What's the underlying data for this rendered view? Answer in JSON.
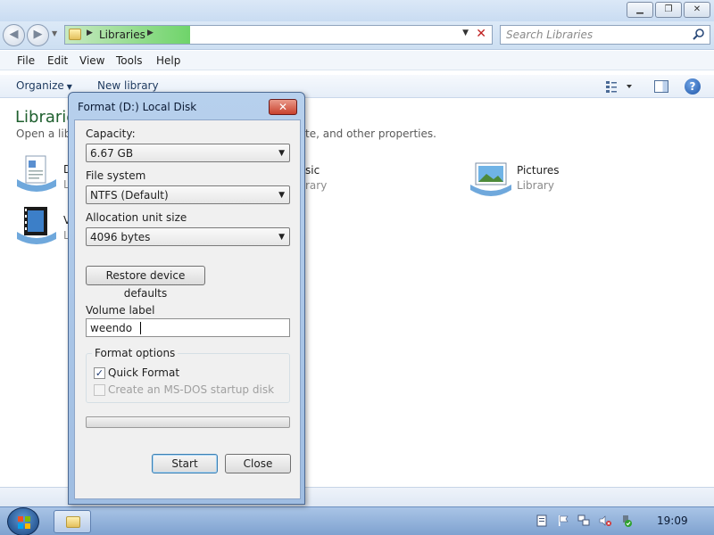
{
  "explorer": {
    "address": {
      "crumb": "Libraries"
    },
    "search": {
      "placeholder": "Search Libraries"
    },
    "menu": [
      "File",
      "Edit",
      "View",
      "Tools",
      "Help"
    ],
    "commands": {
      "organize": "Organize",
      "new_library": "New library"
    },
    "content": {
      "title": "Librarie",
      "subtitle_start": "Open a libr",
      "subtitle_end": "te, and other properties.",
      "tiles": {
        "documents": {
          "name_frag": "D",
          "sub_frag": "L"
        },
        "music": {
          "name": "sic",
          "sub": "rary"
        },
        "videos": {
          "name_frag": "V",
          "sub_frag": "L"
        },
        "pictures": {
          "name": "Pictures",
          "sub": "Library"
        }
      }
    }
  },
  "dialog": {
    "title": "Format (D:) Local Disk",
    "capacity": {
      "label": "Capacity:",
      "value": "6.67 GB"
    },
    "file_system": {
      "label": "File system",
      "value": "NTFS (Default)"
    },
    "allocation": {
      "label": "Allocation unit size",
      "value": "4096 bytes"
    },
    "restore_button": "Restore device defaults",
    "volume_label": {
      "label": "Volume label",
      "value": "weendo"
    },
    "format_options": {
      "title": "Format options",
      "quick_format": {
        "label": "Quick Format",
        "checked": true
      },
      "msdos_disk": {
        "label": "Create an MS-DOS startup disk",
        "checked": false,
        "enabled": false
      }
    },
    "progress": 0,
    "start_button": "Start",
    "close_button": "Close"
  },
  "taskbar": {
    "clock": "19:09"
  },
  "colors": {
    "accent": "#1e5f2e",
    "progress_green": "#37b02b",
    "close_red": "#c8412d"
  }
}
